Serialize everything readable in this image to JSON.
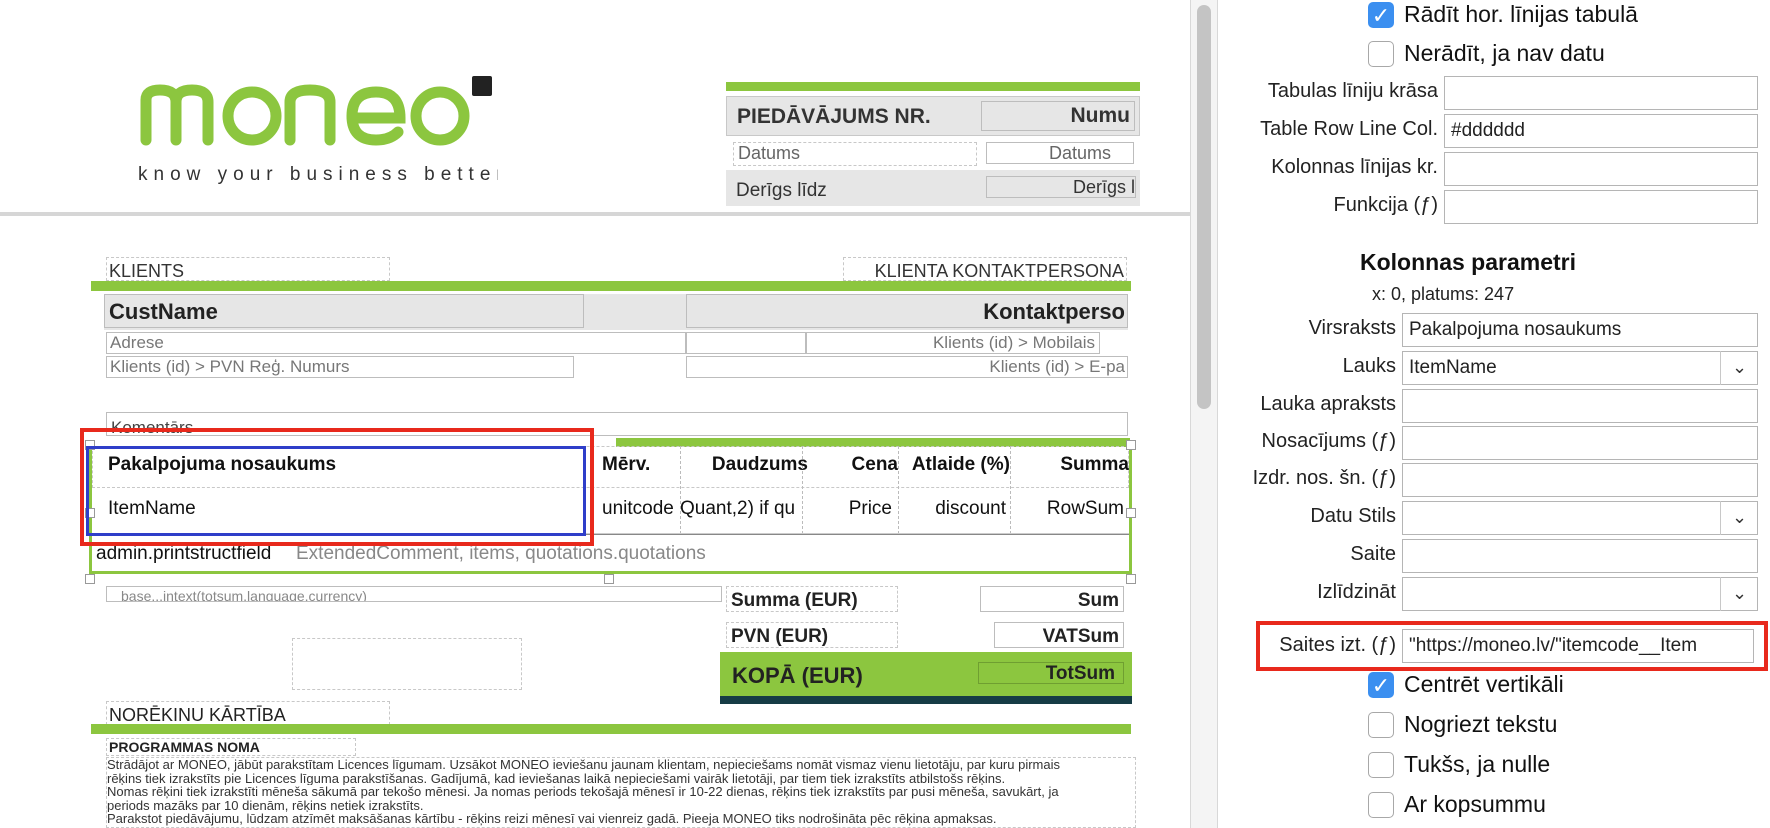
{
  "canvas": {
    "logo": {
      "name": "moneo",
      "tagline": "know your business better"
    },
    "header": {
      "offer_label": "PIEDĀVĀJUMS NR.",
      "number_field": "Numu",
      "date_label": "Datums",
      "date_field": "Datums",
      "valid_label": "Derīgs līdz",
      "valid_field": "Derīgs l"
    },
    "client": {
      "clients_label": "KLIENTS",
      "contact_label": "KLIENTA KONTAKTPERSONA",
      "cust_name": "CustName",
      "contact_field": "Kontaktperso",
      "address": "Adrese",
      "mobile": "Klients (id) > Mobilais",
      "vat_reg": "Klients (id) > PVN Reģ. Numurs",
      "email": "Klients (id) > E-pa"
    },
    "comment_label": "Komentārs",
    "table": {
      "headers": [
        "Pakalpojuma nosaukums",
        "Mērv.",
        "Daudzums",
        "Cena",
        "Atlaide (%)",
        "Summa"
      ],
      "row": [
        "ItemName",
        "unitcode",
        "Quant,2) if qu",
        "Price",
        "discount",
        "RowSum"
      ],
      "struct_field": "admin.printstructfield",
      "struct_value": "ExtendedComment, items, quotations.quotations"
    },
    "totals": {
      "intext": "base...intext(totsum,language,currency)",
      "sum_label": "Summa (EUR)",
      "sum_value": "Sum",
      "vat_label": "PVN (EUR)",
      "vat_value": "VATSum",
      "total_label": "KOPĀ (EUR)",
      "total_value": "TotSum"
    },
    "payment": {
      "title": "NORĒKINU KĀRTĪBA",
      "subtitle": "PROGRAMMAS NOMA",
      "lines": [
        "Strādājot ar MONEO, jābūt parakstītam Licences līgumam. Uzsākot MONEO ieviešanu jaunam klientam, nepieciešams nomāt vismaz vienu lietotāju, par kuru pirmais",
        "rēķins tiek izrakstīts pie Licences līguma parakstīšanas. Gadījumā, kad ieviešanas laikā nepieciešami vairāk lietotāji, par tiem tiek izrakstīts atbilstošs rēķins.",
        "Nomas rēķini tiek izrakstīti mēneša sākumā par tekošo mēnesi. Ja nomas periods tekošajā mēnesī ir 10-22 dienas, rēķins tiek izrakstīts par pusi mēneša, savukārt, ja",
        "periods mazāks par 10 dienām, rēķins netiek izrakstīts.",
        "Parakstot piedāvājumu, lūdzam atzīmēt maksāšanas kārtību - rēķins reizi mēnesī vai vienreiz gadā. Pieeja MONEO tiks nodrošināta pēc rēķina apmaksas."
      ]
    }
  },
  "panel": {
    "cb_show_lines": "Rādīt hor. līnijas tabulā",
    "cb_hide_nodata": "Nerādīt, ja nav datu",
    "table_line_color_label": "Tabulas līniju krāsa",
    "table_line_color_value": "",
    "row_line_color_label": "Table Row Line Col.",
    "row_line_color_value": "#dddddd",
    "col_line_color_label": "Kolonnas līnijas kr.",
    "col_line_color_value": "",
    "function_label": "Funkcija (ƒ)",
    "function_value": "",
    "section_title": "Kolonnas parametri",
    "coords": "x: 0, platums: 247",
    "heading_label": "Virsraksts",
    "heading_value": "Pakalpojuma nosaukums",
    "field_label": "Lauks",
    "field_value": "ItemName",
    "field_desc_label": "Lauka apraksts",
    "condition_label": "Nosacījums (ƒ)",
    "print_label": "Izdr. nos. šn. (ƒ)",
    "data_style_label": "Datu Stils",
    "link_label": "Saite",
    "align_label": "Izlīdzināt",
    "link_expr_label": "Saites izt. (ƒ)",
    "link_expr_value": "\"https://moneo.lv/\"itemcode__Item",
    "cb_center_vert": "Centrēt vertikāli",
    "cb_cut_text": "Nogriezt tekstu",
    "cb_empty_zero": "Tukšs, ja nulle",
    "cb_with_total": "Ar kopsummu"
  },
  "colors": {
    "accent_green": "#8cc63f",
    "dark_teal": "#163c45",
    "highlight_red": "#e8291c",
    "highlight_blue": "#2f3ec9",
    "checkbox_blue": "#3b8ff0"
  }
}
